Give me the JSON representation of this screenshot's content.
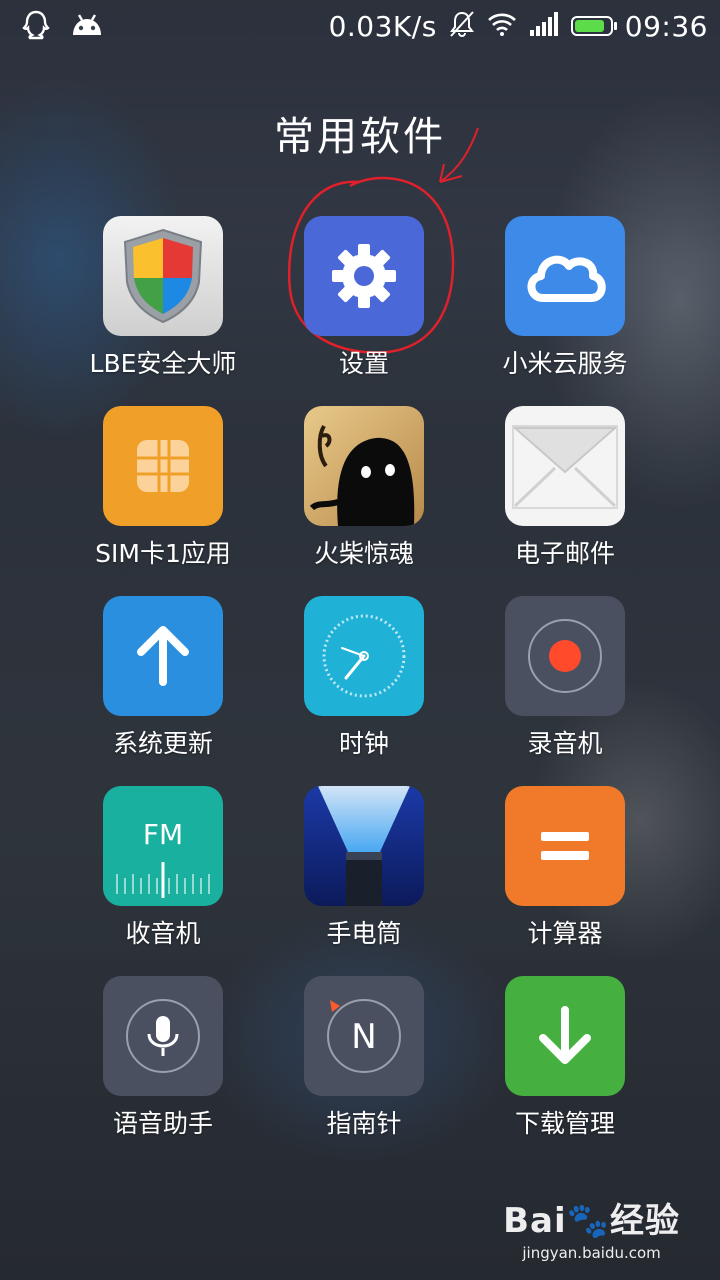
{
  "status_bar": {
    "net_speed": "0.03K/s",
    "time": "09:36",
    "battery_level": 0.85,
    "left_icons": [
      "qq-icon",
      "android-icon"
    ],
    "right_icons": [
      "mute-bell-icon",
      "wifi-icon",
      "signal-icon",
      "battery-icon"
    ]
  },
  "folder": {
    "title": "常用软件",
    "apps": [
      {
        "label": "LBE安全大师",
        "icon": "shield-icon"
      },
      {
        "label": "设置",
        "icon": "gear-icon"
      },
      {
        "label": "小米云服务",
        "icon": "cloud-icon"
      },
      {
        "label": "SIM卡1应用",
        "icon": "sim-card-icon"
      },
      {
        "label": "火柴惊魂",
        "icon": "game-character-icon"
      },
      {
        "label": "电子邮件",
        "icon": "envelope-icon"
      },
      {
        "label": "系统更新",
        "icon": "arrow-up-icon"
      },
      {
        "label": "时钟",
        "icon": "clock-icon"
      },
      {
        "label": "录音机",
        "icon": "record-icon"
      },
      {
        "label": "收音机",
        "icon": "fm-radio-icon"
      },
      {
        "label": "手电筒",
        "icon": "flashlight-icon"
      },
      {
        "label": "计算器",
        "icon": "equals-icon"
      },
      {
        "label": "语音助手",
        "icon": "microphone-icon"
      },
      {
        "label": "指南针",
        "icon": "compass-icon"
      },
      {
        "label": "下载管理",
        "icon": "arrow-down-icon"
      }
    ]
  },
  "watermark": {
    "brand_latin": "Bai",
    "brand_cn": "经验",
    "url": "jingyan.baidu.com"
  },
  "colors": {
    "settings": "#4a68d8",
    "cloud": "#3d8ae8",
    "sim": "#f0a028",
    "update": "#2b8fe0",
    "clock": "#1fb1d6",
    "recorder": "#4a5060",
    "fm": "#1ab0a0",
    "calculator": "#f07a2a",
    "download": "#45b040",
    "annotation_red": "#e0202a"
  }
}
